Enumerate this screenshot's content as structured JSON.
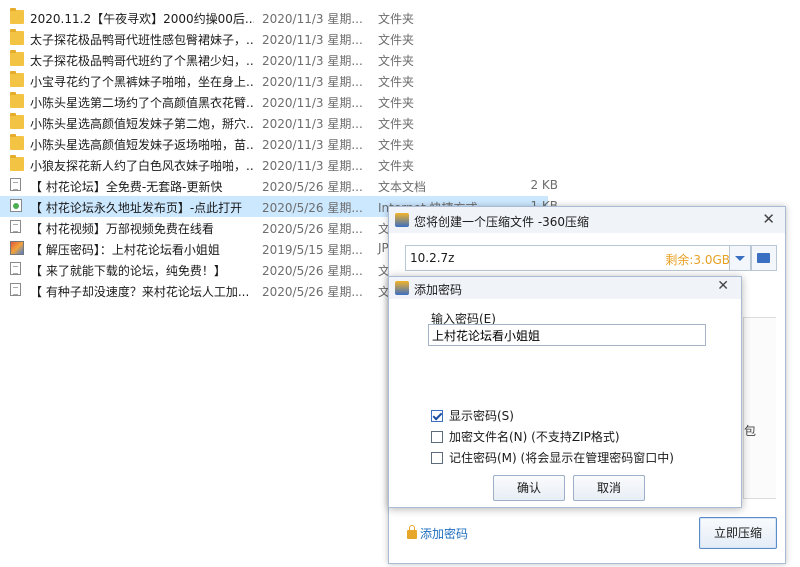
{
  "files": [
    {
      "icon": "folder-icon",
      "name": "2020.11.2【午夜寻欢】2000约操00后...",
      "date": "2020/11/3 星期...",
      "type": "文件夹",
      "size": ""
    },
    {
      "icon": "folder-icon",
      "name": "太子探花极品鸭哥代班性感包臀裙妹子，...",
      "date": "2020/11/3 星期...",
      "type": "文件夹",
      "size": ""
    },
    {
      "icon": "folder-icon",
      "name": "太子探花极品鸭哥代班约了个黑裙少妇，...",
      "date": "2020/11/3 星期...",
      "type": "文件夹",
      "size": ""
    },
    {
      "icon": "folder-icon",
      "name": "小宝寻花约了个黑裤妹子啪啪，坐在身上...",
      "date": "2020/11/3 星期...",
      "type": "文件夹",
      "size": ""
    },
    {
      "icon": "folder-icon",
      "name": "小陈头星选第二场约了个高颜值黑衣花臂...",
      "date": "2020/11/3 星期...",
      "type": "文件夹",
      "size": ""
    },
    {
      "icon": "folder-icon",
      "name": "小陈头星选高颜值短发妹子第二炮，掰穴...",
      "date": "2020/11/3 星期...",
      "type": "文件夹",
      "size": ""
    },
    {
      "icon": "folder-icon",
      "name": "小陈头星选高颜值短发妹子返场啪啪，苗...",
      "date": "2020/11/3 星期...",
      "type": "文件夹",
      "size": ""
    },
    {
      "icon": "folder-icon",
      "name": "小狼友探花新人约了白色风衣妹子啪啪，...",
      "date": "2020/11/3 星期...",
      "type": "文件夹",
      "size": ""
    },
    {
      "icon": "doc-icon",
      "name": "【 村花论坛】全免费-无套路-更新快",
      "date": "2020/5/26 星期...",
      "type": "文本文档",
      "size": "2 KB"
    },
    {
      "icon": "url-icon",
      "name": "【 村花论坛永久地址发布页】-点此打开",
      "date": "2020/5/26 星期...",
      "type": "Internet 快捷方式",
      "size": "1 KB"
    },
    {
      "icon": "doc-icon",
      "name": "【 村花视频】万部视频免费在线看",
      "date": "2020/5/26 星期...",
      "type": "文",
      "size": ""
    },
    {
      "icon": "img-icon",
      "name": "【 解压密码】：上村花论坛看小姐姐",
      "date": "2019/5/15 星期...",
      "type": "JP",
      "size": ""
    },
    {
      "icon": "doc-icon",
      "name": "【 来了就能下载的论坛，纯免费！】",
      "date": "2020/5/26 星期...",
      "type": "文",
      "size": ""
    },
    {
      "icon": "doc-icon",
      "name": "【 有种子却没速度？来村花论坛人工加...",
      "date": "2020/5/26 星期...",
      "type": "文",
      "size": ""
    }
  ],
  "compress_window": {
    "title": "您将创建一个压缩文件 -360压缩",
    "close": "✕",
    "path": "10.2.7z",
    "free_space": "剩余:3.0GB",
    "panel_fragment": "包",
    "add_password": "添加密码",
    "compress_button": "立即压缩"
  },
  "password_dialog": {
    "title": "添加密码",
    "close": "✕",
    "input_label": "输入密码(E)",
    "password_value": "上村花论坛看小姐姐",
    "show_password": "显示密码(S)",
    "encrypt_filenames": "加密文件名(N) (不支持ZIP格式)",
    "remember_password": "记住密码(M) (将会显示在管理密码窗口中)",
    "ok": "确认",
    "cancel": "取消",
    "show_password_checked": true,
    "encrypt_filenames_checked": false,
    "remember_password_checked": false
  }
}
